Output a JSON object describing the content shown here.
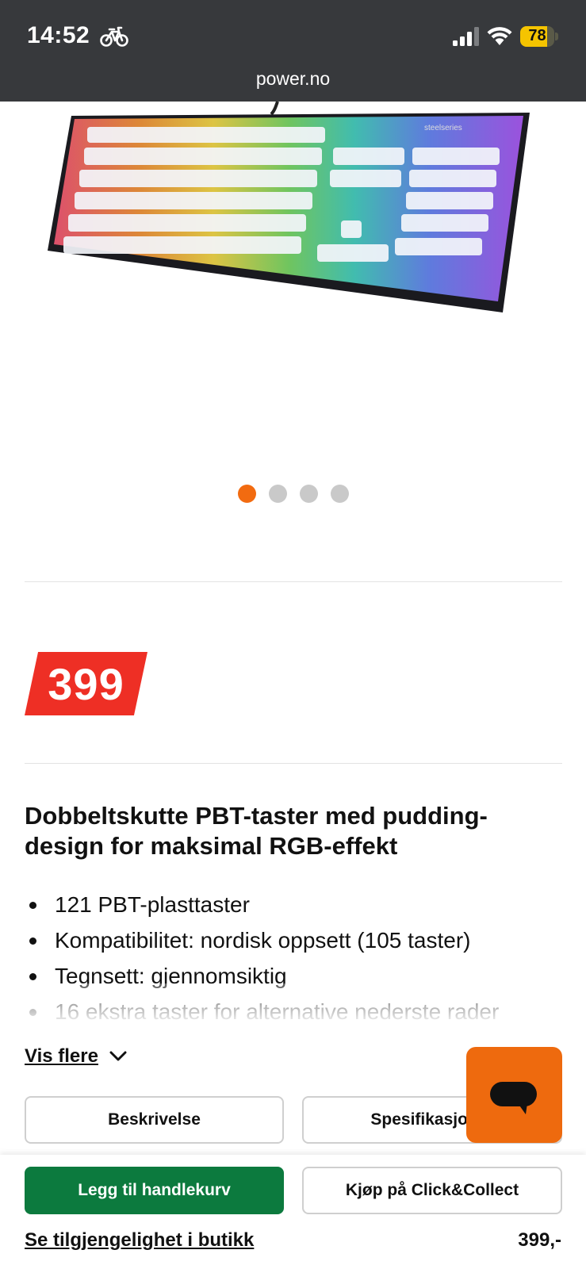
{
  "status_bar": {
    "time": "14:52",
    "battery": "78",
    "battery_level": 0.78
  },
  "browser": {
    "url": "power.no"
  },
  "carousel": {
    "count": 4,
    "active_index": 0
  },
  "product": {
    "price": "399",
    "title": "Dobbeltskutte PBT-taster med pudding-design for maksimal RGB-effekt",
    "features": [
      "121 PBT-plasttaster",
      "Kompatibilitet: nordisk oppsett (105 taster)",
      "Tegnsett: gjennomsiktig",
      "16 ekstra taster for alternative nederste rader"
    ],
    "show_more": "Vis flere"
  },
  "tabs": {
    "description": "Beskrivelse",
    "specifications": "Spesifikasjoner"
  },
  "bottom_bar": {
    "add_to_cart": "Legg til handlekurv",
    "click_collect": "Kjøp på Click&Collect",
    "store_availability": "Se tilgjengelighet i butikk",
    "price": "399,-"
  },
  "colors": {
    "accent": "#f26b10",
    "cart": "#0c7a3e",
    "price_tag": "#ee2f25",
    "chat": "#ee6a0e"
  },
  "icons": [
    "bicycle-icon",
    "cellular-signal-icon",
    "wifi-icon",
    "battery-icon",
    "chevron-down-icon",
    "chat-icon"
  ]
}
